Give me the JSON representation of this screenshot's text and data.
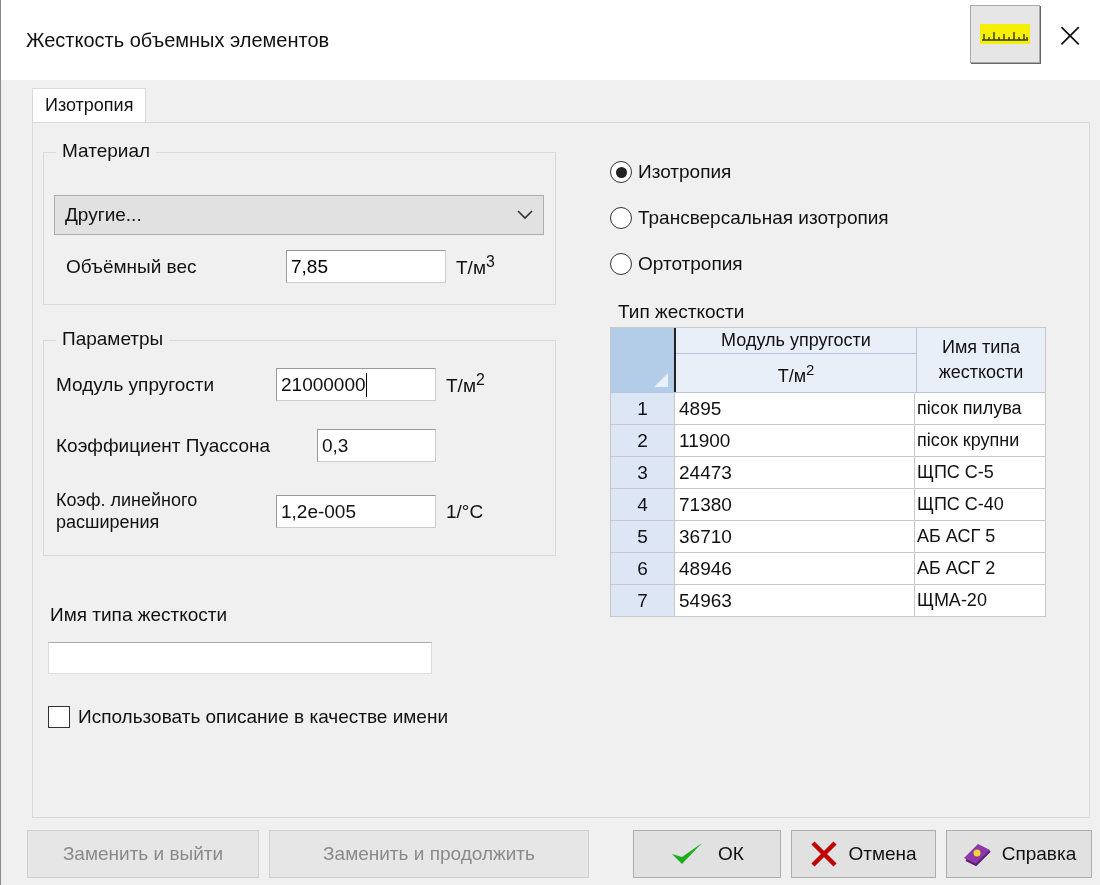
{
  "window": {
    "title": "Жесткость объемных элементов",
    "close": "×"
  },
  "tabs": [
    {
      "label": "Изотропия",
      "selected": true
    }
  ],
  "material": {
    "title": "Материал",
    "dropdown": {
      "value": "Другие..."
    },
    "fields": [
      {
        "label": "Объёмный вес",
        "value": "7,85",
        "unit": "Т/м$^{3}$"
      }
    ]
  },
  "parameters": {
    "title": "Параметры",
    "fields": [
      {
        "label": "Модуль упругости",
        "value": "21000000",
        "unit": "Т/м$^{2}$",
        "focused": true
      },
      {
        "label": "Коэффициент Пуассона",
        "value": "0,3",
        "focused": false
      },
      {
        "label": "Коэф. линейного расширения",
        "value": "1,2e-005",
        "unit": "1/°C",
        "focused": false
      }
    ]
  },
  "name_field": {
    "label": "Имя типа жесткости"
  },
  "use_description": {
    "label": "Использовать описание в качестве имени",
    "checked": false
  },
  "anisotropy": [
    {
      "label": "Изотропия",
      "selected": true
    },
    {
      "label": "Трансверсальная изотропия",
      "selected": false
    },
    {
      "label": "Ортотропия",
      "selected": false
    }
  ],
  "stiffness_table": {
    "title": "Тип жесткости",
    "columns": [
      {
        "label": "Модуль упругости",
        "unit": "Т/м$^{2}$"
      },
      {
        "label": "Имя типа жесткости"
      }
    ],
    "rows": [
      {
        "number": "1",
        "modulus": "4895",
        "name": "пісок пилува"
      },
      {
        "number": "2",
        "modulus": "11900",
        "name": "пісок крупни"
      },
      {
        "number": "3",
        "modulus": "24473",
        "name": "ЩПС С-5"
      },
      {
        "number": "4",
        "modulus": "71380",
        "name": "ЩПС С-40"
      },
      {
        "number": "5",
        "modulus": "36710",
        "name": "АБ АСГ 5"
      },
      {
        "number": "6",
        "modulus": "48946",
        "name": "АБ АСГ 2"
      },
      {
        "number": "7",
        "modulus": "54963",
        "name": "ЩМА-20"
      }
    ]
  },
  "buttons": [
    {
      "label": "Заменить и выйти",
      "kind": "plain",
      "disabled": true
    },
    {
      "label": "Заменить и продолжить",
      "kind": "plain",
      "disabled": true
    },
    {
      "label": "ОК",
      "kind": "ok",
      "disabled": false
    },
    {
      "label": "Отмена",
      "kind": "cancel",
      "disabled": false
    },
    {
      "label": "Справка",
      "kind": "help",
      "disabled": false
    }
  ]
}
